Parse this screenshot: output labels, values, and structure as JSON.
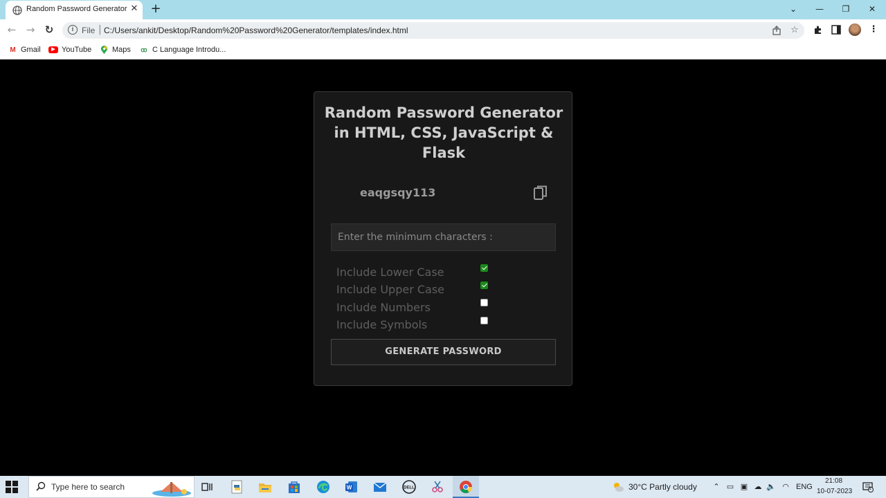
{
  "browser": {
    "tab": {
      "title": "Random Password Generator",
      "close": "✕"
    },
    "new_tab": "+",
    "window_controls": {
      "chevron": "⌄",
      "minimize": "—",
      "restore": "❐",
      "close": "✕"
    },
    "nav": {
      "back": "←",
      "forward": "→",
      "reload": "↻"
    },
    "address": {
      "scheme_label": "File",
      "separator": "|",
      "url": "C:/Users/ankit/Desktop/Random%20Password%20Generator/templates/index.html"
    },
    "bookmarks": [
      {
        "label": "Gmail",
        "icon": "gmail-icon",
        "glyph": "M",
        "color": "#d93025"
      },
      {
        "label": "YouTube",
        "icon": "youtube-icon",
        "glyph": "▶",
        "color": "#ff0000"
      },
      {
        "label": "Maps",
        "icon": "maps-icon",
        "glyph": "⬤",
        "color": "#34a853"
      },
      {
        "label": "C Language Introdu...",
        "icon": "gfg-icon",
        "glyph": "∂",
        "color": "#2f8d46"
      }
    ]
  },
  "app": {
    "title": "Random Password Generator in HTML, CSS, JavaScript & Flask",
    "password": "eaqgsqy113",
    "min_chars_placeholder": "Enter the minimum characters :",
    "options": [
      {
        "label": "Include Lower Case",
        "checked": true
      },
      {
        "label": "Include Upper Case",
        "checked": true
      },
      {
        "label": "Include Numbers",
        "checked": false
      },
      {
        "label": "Include Symbols",
        "checked": false
      }
    ],
    "generate_label": "GENERATE PASSWORD"
  },
  "taskbar": {
    "search_placeholder": "Type here to search",
    "weather": "30°C  Partly cloudy",
    "language": "ENG",
    "time": "21:08",
    "date": "10-07-2023",
    "notification_count": "1"
  },
  "colors": {
    "page_bg": "#000000",
    "card_bg": "#181818",
    "accent_check": "#1a8a1a",
    "titlebar": "#a8dcea"
  }
}
